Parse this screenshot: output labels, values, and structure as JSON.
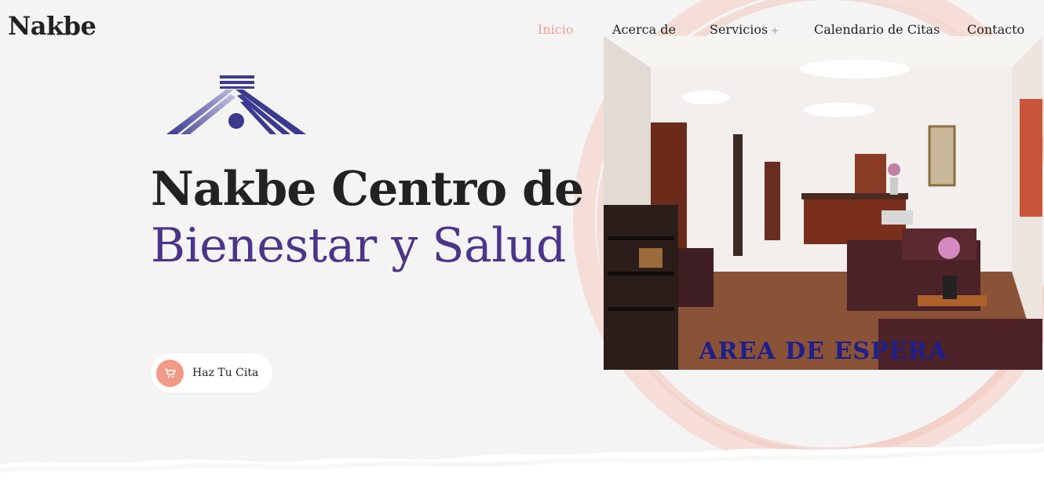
{
  "header": {
    "brand": "Nakbe"
  },
  "nav": {
    "items": [
      {
        "label": "Inicio",
        "active": true
      },
      {
        "label": "Acerca de"
      },
      {
        "label": "Servicios"
      },
      {
        "label": "Calendario de Citas"
      },
      {
        "label": "Contacto"
      }
    ],
    "services_expand": "+"
  },
  "hero": {
    "title_line1": "Nakbe Centro de",
    "title_line2": "Bienestar y Salud",
    "cta_label": "Haz Tu Cita",
    "cta_icon": "cart-icon",
    "logo_icon": "house-roof-logo"
  },
  "photo": {
    "caption": "AREA DE ESPERA"
  },
  "colors": {
    "accent": "#f19a85",
    "title_purple": "#4b3589",
    "logo_blue": "#3b3a8f",
    "caption_blue": "#1d1f8d",
    "ring": "#f6ddd7"
  }
}
